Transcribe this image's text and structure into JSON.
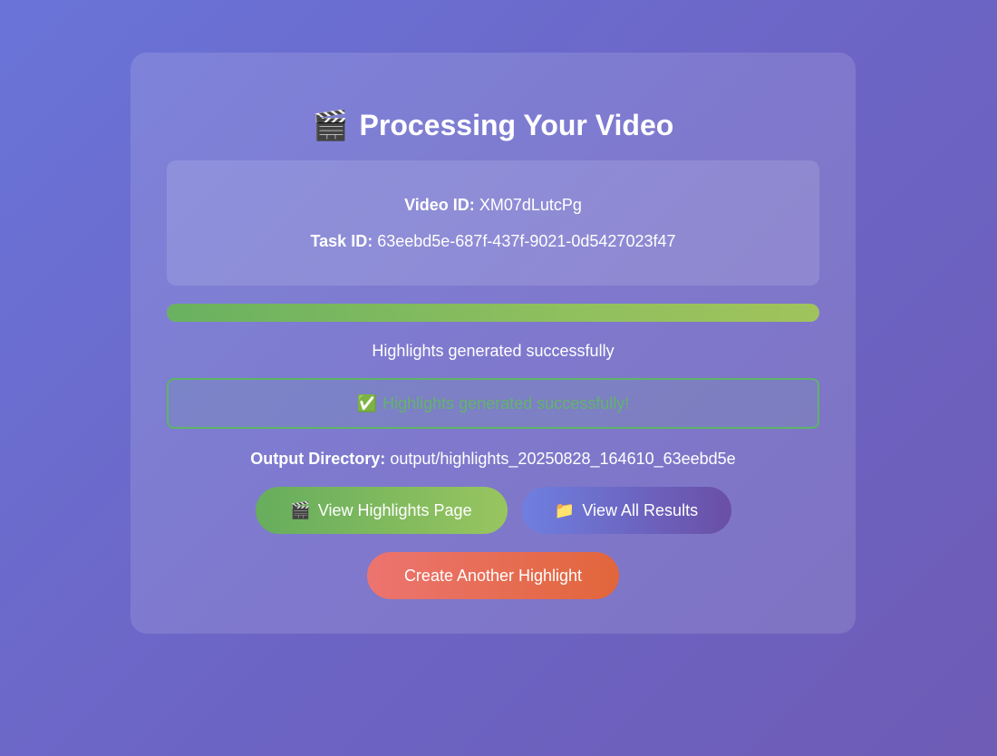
{
  "header": {
    "icon": "🎬",
    "icon_name": "clapperboard-icon",
    "title": "Processing Your Video"
  },
  "info": {
    "video_id_label": "Video ID:",
    "video_id": "XM07dLutcPg",
    "task_id_label": "Task ID:",
    "task_id": "63eebd5e-687f-437f-9021-0d5427023f47"
  },
  "progress": {
    "percent": 100,
    "status_text": "Highlights generated successfully"
  },
  "success": {
    "icon": "✅",
    "icon_name": "check-mark-icon",
    "message": "Highlights generated successfully!"
  },
  "output": {
    "label": "Output Directory:",
    "path": "output/highlights_20250828_164610_63eebd5e"
  },
  "buttons": {
    "view_highlights": {
      "icon": "🎬",
      "icon_name": "clapperboard-icon",
      "label": "View Highlights Page"
    },
    "view_results": {
      "icon": "📁",
      "icon_name": "folder-icon",
      "label": "View All Results"
    },
    "create_another": {
      "label": "Create Another Highlight"
    }
  },
  "colors": {
    "background": "#6b6ccc",
    "success_green": "#62b46a",
    "progress_start": "#69b160",
    "progress_end": "#a0c35c",
    "button_green_start": "#66ad5d",
    "button_purple_start": "#6f7fe0",
    "button_orange_start": "#ec7470"
  }
}
